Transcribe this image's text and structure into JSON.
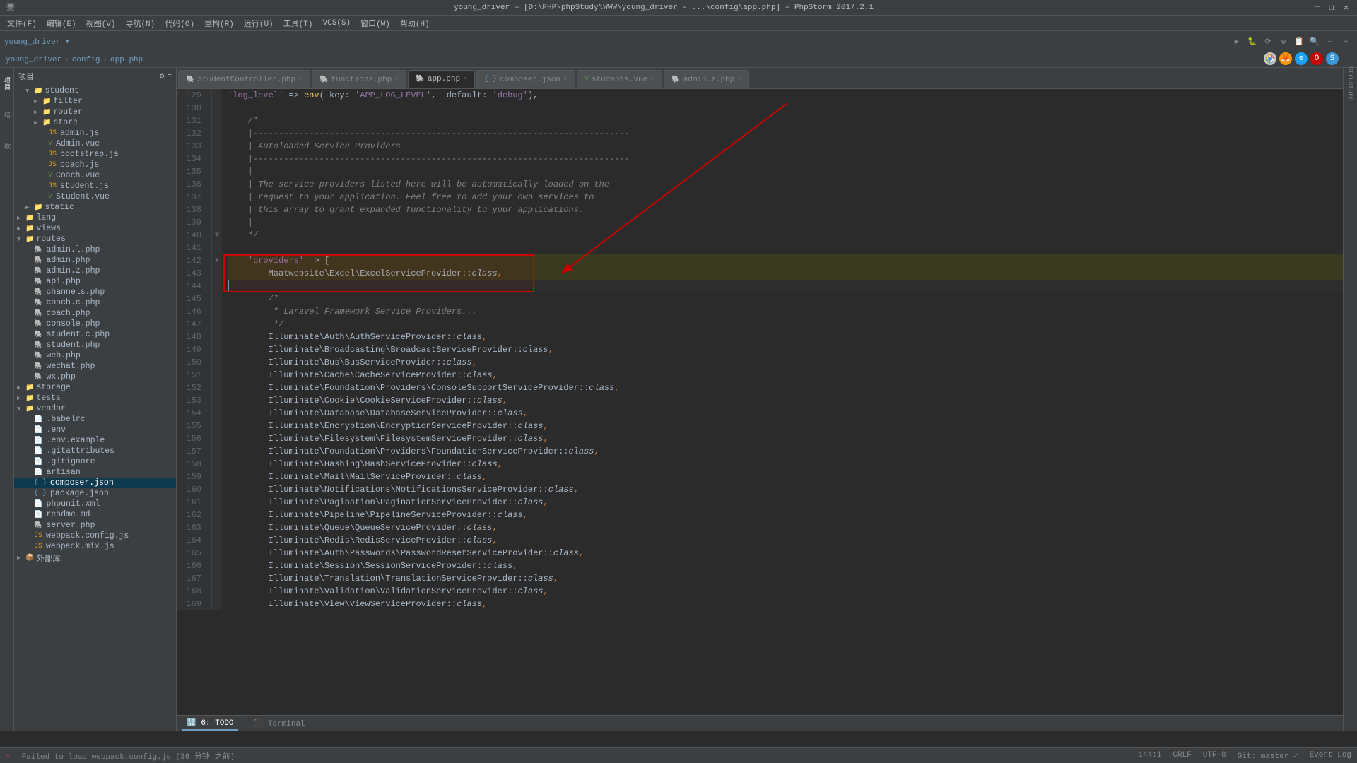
{
  "titlebar": {
    "title": "young_driver – [D:\\PHP\\phpStudy\\WWW\\young_driver – ...\\config\\app.php] – PhpStorm 2017.2.1",
    "minimize": "—",
    "maximize": "❒",
    "close": "✕"
  },
  "menubar": {
    "items": [
      "文件(F)",
      "编辑(E)",
      "视图(V)",
      "导航(N)",
      "代码(O)",
      "重构(R)",
      "运行(U)",
      "工具(T)",
      "VCS(S)",
      "窗口(W)",
      "帮助(H)"
    ]
  },
  "breadcrumb": {
    "parts": [
      "young_driver",
      "config",
      "app.php"
    ]
  },
  "tabs": [
    {
      "label": "StudentController.php",
      "active": false
    },
    {
      "label": "functions.php",
      "active": false
    },
    {
      "label": "app.php",
      "active": true
    },
    {
      "label": "composer.json",
      "active": false
    },
    {
      "label": "students.vue",
      "active": false
    },
    {
      "label": "admin.z.php",
      "active": false
    }
  ],
  "filetree": {
    "header": "项目",
    "items": [
      {
        "indent": 4,
        "type": "folder",
        "label": "student",
        "expanded": true
      },
      {
        "indent": 6,
        "type": "folder",
        "label": "filter",
        "expanded": false
      },
      {
        "indent": 6,
        "type": "folder",
        "label": "router",
        "expanded": false
      },
      {
        "indent": 6,
        "type": "folder",
        "label": "store",
        "expanded": false
      },
      {
        "indent": 6,
        "type": "js-file",
        "label": "admin.js"
      },
      {
        "indent": 6,
        "type": "vue-file",
        "label": "Admin.vue"
      },
      {
        "indent": 6,
        "type": "js-file",
        "label": "bootstrap.js"
      },
      {
        "indent": 6,
        "type": "js-file",
        "label": "coach.js"
      },
      {
        "indent": 6,
        "type": "vue-file",
        "label": "Coach.vue"
      },
      {
        "indent": 6,
        "type": "js-file",
        "label": "student.js"
      },
      {
        "indent": 6,
        "type": "vue-file",
        "label": "Student.vue"
      },
      {
        "indent": 4,
        "type": "folder",
        "label": "static",
        "expanded": false
      },
      {
        "indent": 2,
        "type": "folder",
        "label": "lang",
        "expanded": false
      },
      {
        "indent": 2,
        "type": "folder",
        "label": "views",
        "expanded": false
      },
      {
        "indent": 2,
        "type": "folder",
        "label": "routes",
        "expanded": true
      },
      {
        "indent": 4,
        "type": "php-file",
        "label": "admin.l.php"
      },
      {
        "indent": 4,
        "type": "php-file",
        "label": "admin.php"
      },
      {
        "indent": 4,
        "type": "php-file",
        "label": "admin.z.php"
      },
      {
        "indent": 4,
        "type": "php-file",
        "label": "api.php"
      },
      {
        "indent": 4,
        "type": "php-file",
        "label": "channels.php"
      },
      {
        "indent": 4,
        "type": "php-file",
        "label": "coach.c.php"
      },
      {
        "indent": 4,
        "type": "php-file",
        "label": "coach.php"
      },
      {
        "indent": 4,
        "type": "php-file",
        "label": "console.php"
      },
      {
        "indent": 4,
        "type": "php-file",
        "label": "student.c.php"
      },
      {
        "indent": 4,
        "type": "php-file",
        "label": "student.php"
      },
      {
        "indent": 4,
        "type": "php-file",
        "label": "web.php"
      },
      {
        "indent": 4,
        "type": "php-file",
        "label": "wechat.php"
      },
      {
        "indent": 4,
        "type": "php-file",
        "label": "wx.php"
      },
      {
        "indent": 2,
        "type": "folder",
        "label": "storage",
        "expanded": false
      },
      {
        "indent": 2,
        "type": "folder",
        "label": "tests",
        "expanded": false
      },
      {
        "indent": 2,
        "type": "folder",
        "label": "vendor",
        "expanded": true
      },
      {
        "indent": 4,
        "type": "misc-file",
        "label": ".babelrc"
      },
      {
        "indent": 4,
        "type": "misc-file",
        "label": ".env"
      },
      {
        "indent": 4,
        "type": "misc-file",
        "label": ".env.example"
      },
      {
        "indent": 4,
        "type": "misc-file",
        "label": ".gitattributes"
      },
      {
        "indent": 4,
        "type": "misc-file",
        "label": ".gitignore"
      },
      {
        "indent": 4,
        "type": "misc-file",
        "label": "artisan"
      },
      {
        "indent": 4,
        "type": "json-file",
        "label": "composer.json",
        "selected": true
      },
      {
        "indent": 4,
        "type": "json-file",
        "label": "package.json"
      },
      {
        "indent": 4,
        "type": "misc-file",
        "label": "phpunit.xml"
      },
      {
        "indent": 4,
        "type": "misc-file",
        "label": "readme.md"
      },
      {
        "indent": 4,
        "type": "php-file",
        "label": "server.php"
      },
      {
        "indent": 4,
        "type": "js-file",
        "label": "webpack.config.js"
      },
      {
        "indent": 4,
        "type": "js-file",
        "label": "webpack.mix.js"
      },
      {
        "indent": 2,
        "type": "folder",
        "label": "外部库",
        "expanded": false
      }
    ]
  },
  "code": {
    "lines": [
      {
        "num": 129,
        "fold": false,
        "highlight": false,
        "content": "    'log_level' => env( key: 'APP_LOG_LEVEL',  default: 'debug'),"
      },
      {
        "num": 130,
        "fold": false,
        "highlight": false,
        "content": ""
      },
      {
        "num": 131,
        "fold": false,
        "highlight": false,
        "content": "    /*"
      },
      {
        "num": 132,
        "fold": false,
        "highlight": false,
        "content": "    |--------------------------------------------------------------------------"
      },
      {
        "num": 133,
        "fold": false,
        "highlight": false,
        "content": "    | Autoloaded Service Providers"
      },
      {
        "num": 134,
        "fold": false,
        "highlight": false,
        "content": "    |--------------------------------------------------------------------------"
      },
      {
        "num": 135,
        "fold": false,
        "highlight": false,
        "content": "    |"
      },
      {
        "num": 136,
        "fold": false,
        "highlight": false,
        "content": "    | The service providers listed here will be automatically loaded on the"
      },
      {
        "num": 137,
        "fold": false,
        "highlight": false,
        "content": "    | request to your application. Feel free to add your own services to"
      },
      {
        "num": 138,
        "fold": false,
        "highlight": false,
        "content": "    | this array to grant expanded functionality to your applications."
      },
      {
        "num": 139,
        "fold": false,
        "highlight": false,
        "content": "    |"
      },
      {
        "num": 140,
        "fold": true,
        "highlight": false,
        "content": "    */"
      },
      {
        "num": 141,
        "fold": false,
        "highlight": false,
        "content": ""
      },
      {
        "num": 142,
        "fold": true,
        "highlight": true,
        "content": "    'providers' => ["
      },
      {
        "num": 143,
        "fold": false,
        "highlight": true,
        "content": "        Maatwebsite\\Excel\\ExcelServiceProvider::class,"
      },
      {
        "num": 144,
        "fold": false,
        "highlight": true,
        "content": ""
      },
      {
        "num": 145,
        "fold": false,
        "highlight": false,
        "content": "        /*"
      },
      {
        "num": 146,
        "fold": false,
        "highlight": false,
        "content": "         * Laravel Framework Service Providers..."
      },
      {
        "num": 147,
        "fold": false,
        "highlight": false,
        "content": "         */"
      },
      {
        "num": 148,
        "fold": false,
        "highlight": false,
        "content": "        Illuminate\\Auth\\AuthServiceProvider::class,"
      },
      {
        "num": 149,
        "fold": false,
        "highlight": false,
        "content": "        Illuminate\\Broadcasting\\BroadcastServiceProvider::class,"
      },
      {
        "num": 150,
        "fold": false,
        "highlight": false,
        "content": "        Illuminate\\Bus\\BusServiceProvider::class,"
      },
      {
        "num": 151,
        "fold": false,
        "highlight": false,
        "content": "        Illuminate\\Cache\\CacheServiceProvider::class,"
      },
      {
        "num": 152,
        "fold": false,
        "highlight": false,
        "content": "        Illuminate\\Foundation\\Providers\\ConsoleSupportServiceProvider::class,"
      },
      {
        "num": 153,
        "fold": false,
        "highlight": false,
        "content": "        Illuminate\\Cookie\\CookieServiceProvider::class,"
      },
      {
        "num": 154,
        "fold": false,
        "highlight": false,
        "content": "        Illuminate\\Database\\DatabaseServiceProvider::class,"
      },
      {
        "num": 155,
        "fold": false,
        "highlight": false,
        "content": "        Illuminate\\Encryption\\EncryptionServiceProvider::class,"
      },
      {
        "num": 156,
        "fold": false,
        "highlight": false,
        "content": "        Illuminate\\Filesystem\\FilesystemServiceProvider::class,"
      },
      {
        "num": 157,
        "fold": false,
        "highlight": false,
        "content": "        Illuminate\\Foundation\\Providers\\FoundationServiceProvider::class,"
      },
      {
        "num": 158,
        "fold": false,
        "highlight": false,
        "content": "        Illuminate\\Hashing\\HashServiceProvider::class,"
      },
      {
        "num": 159,
        "fold": false,
        "highlight": false,
        "content": "        Illuminate\\Mail\\MailServiceProvider::class,"
      },
      {
        "num": 160,
        "fold": false,
        "highlight": false,
        "content": "        Illuminate\\Notifications\\NotificationsServiceProvider::class,"
      },
      {
        "num": 161,
        "fold": false,
        "highlight": false,
        "content": "        Illuminate\\Pagination\\PaginationServiceProvider::class,"
      },
      {
        "num": 162,
        "fold": false,
        "highlight": false,
        "content": "        Illuminate\\Pipeline\\PipelineServiceProvider::class,"
      },
      {
        "num": 163,
        "fold": false,
        "highlight": false,
        "content": "        Illuminate\\Queue\\QueueServiceProvider::class,"
      },
      {
        "num": 164,
        "fold": false,
        "highlight": false,
        "content": "        Illuminate\\Redis\\RedisServiceProvider::class,"
      },
      {
        "num": 165,
        "fold": false,
        "highlight": false,
        "content": "        Illuminate\\Auth\\Passwords\\PasswordResetServiceProvider::class,"
      },
      {
        "num": 166,
        "fold": false,
        "highlight": false,
        "content": "        Illuminate\\Session\\SessionServiceProvider::class,"
      },
      {
        "num": 167,
        "fold": false,
        "highlight": false,
        "content": "        Illuminate\\Translation\\TranslationServiceProvider::class,"
      },
      {
        "num": 168,
        "fold": false,
        "highlight": false,
        "content": "        Illuminate\\Validation\\ValidationServiceProvider::class,"
      },
      {
        "num": 169,
        "fold": false,
        "highlight": false,
        "content": "        Illuminate\\View\\ViewServiceProvider::class,"
      }
    ]
  },
  "statusbar": {
    "error_count": "6: TODO",
    "terminal": "Terminal",
    "position": "144:1",
    "line_endings": "CRLF",
    "encoding": "UTF-8",
    "git": "Git: master ✓",
    "event_log": "Event Log",
    "error_msg": "Failed to load webpack.config.js (36 分钟 之前)"
  },
  "right_panel": {
    "label": "Structure"
  }
}
